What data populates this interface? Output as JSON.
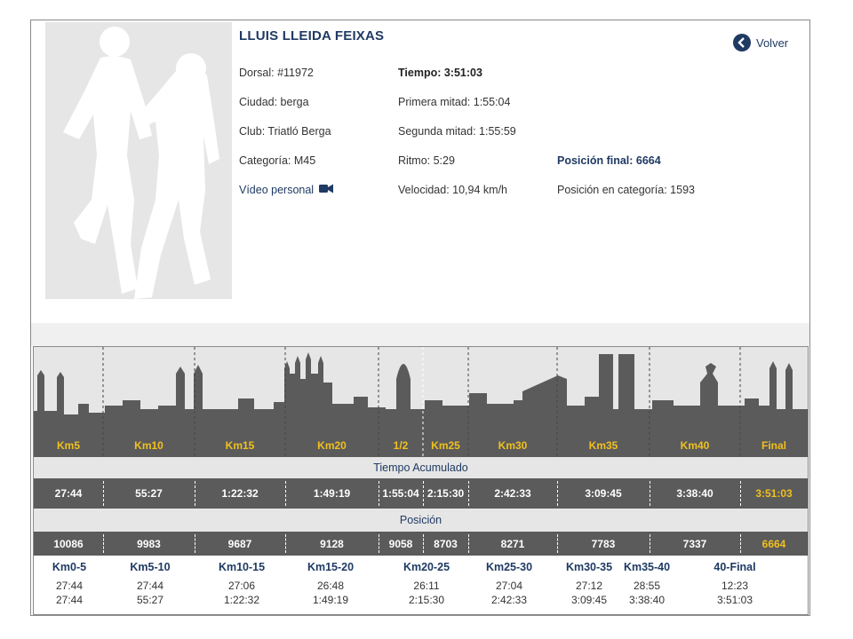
{
  "runner": {
    "name": "LLUIS LLEIDA FEIXAS",
    "dorsal": "Dorsal: #11972",
    "ciudad": "Ciudad: berga",
    "club": "Club: Triatló Berga",
    "categoria": "Categoría: M45",
    "video": "Vídeo personal",
    "tiempo": "Tiempo: 3:51:03",
    "primera_mitad": "Primera mitad: 1:55:04",
    "segunda_mitad": "Segunda mitad: 1:55:59",
    "ritmo": "Ritmo: 5:29",
    "velocidad": "Velocidad: 10,94 km/h",
    "posicion_final": "Posición final: 6664",
    "posicion_categoria": "Posición en categoría: 1593"
  },
  "nav": {
    "back_label": "Volver"
  },
  "colors": {
    "brand": "#1f3a63",
    "accent": "#f0c020",
    "bar": "#5b5b5b"
  },
  "splits": {
    "checkpoints": [
      "Km5",
      "Km10",
      "Km15",
      "Km20",
      "1/2",
      "Km25",
      "Km30",
      "Km35",
      "Km40",
      "Final"
    ],
    "tiempo_header": "Tiempo Acumulado",
    "tiempos": [
      "27:44",
      "55:27",
      "1:22:32",
      "1:49:19",
      "1:55:04",
      "2:15:30",
      "2:42:33",
      "3:09:45",
      "3:38:40",
      "3:51:03"
    ],
    "posicion_header": "Posición",
    "posiciones": [
      "10086",
      "9983",
      "9687",
      "9128",
      "9058",
      "8703",
      "8271",
      "7783",
      "7337",
      "6664"
    ]
  },
  "segments": [
    {
      "label": "Km0-5",
      "parcial": "27:44",
      "acumulado": "27:44"
    },
    {
      "label": "Km5-10",
      "parcial": "27:44",
      "acumulado": "55:27"
    },
    {
      "label": "Km10-15",
      "parcial": "27:06",
      "acumulado": "1:22:32"
    },
    {
      "label": "Km15-20",
      "parcial": "26:48",
      "acumulado": "1:49:19"
    },
    {
      "label": "Km20-25",
      "parcial": "26:11",
      "acumulado": "2:15:30"
    },
    {
      "label": "Km25-30",
      "parcial": "27:04",
      "acumulado": "2:42:33"
    },
    {
      "label": "Km30-35",
      "parcial": "27:12",
      "acumulado": "3:09:45"
    },
    {
      "label": "Km35-40",
      "parcial": "28:55",
      "acumulado": "3:38:40"
    },
    {
      "label": "40-Final",
      "parcial": "12:23",
      "acumulado": "3:51:03"
    }
  ]
}
